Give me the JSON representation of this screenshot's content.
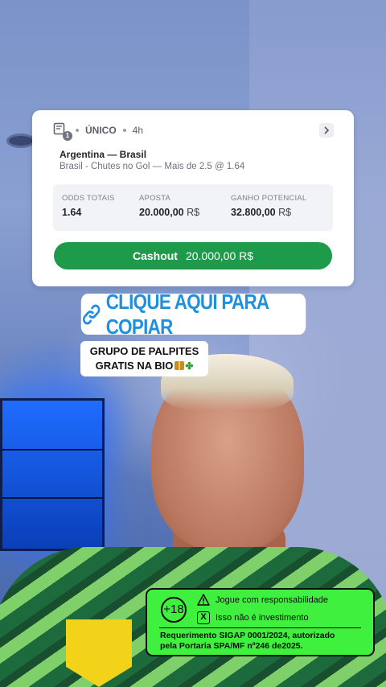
{
  "bet_slip": {
    "count": "1",
    "type": "ÚNICO",
    "time": "4h",
    "match": "Argentina — Brasil",
    "selection": "Brasil - Chutes no Gol — Mais de 2.5 @ 1.64",
    "stats": {
      "odds_label": "ODDS TOTAIS",
      "odds_value": "1.64",
      "stake_label": "APOSTA",
      "stake_value": "20.000,00",
      "stake_currency": "R$",
      "potential_label": "GANHO POTENCIAL",
      "potential_value": "32.800,00",
      "potential_currency": "R$"
    },
    "cashout": {
      "label": "Cashout",
      "amount": "20.000,00 R$",
      "color": "#1e9a4b"
    }
  },
  "copy_banner": {
    "text": "CLIQUE AQUI PARA COPIAR",
    "color": "#1f8fe0",
    "icon": "link-icon"
  },
  "group_label": {
    "line1": "GRUPO DE PALPITES",
    "line2": "GRATIS NA BIO"
  },
  "responsible": {
    "age": "+18",
    "line1": "Jogue com responsabilidade",
    "line2": "Isso não é investimento",
    "x_mark": "X",
    "legal_line1": "Requerimento SIGAP 0001/2024, autorizado",
    "legal_line2": "pela Portaria SPA/MF nº246 de2025.",
    "color": "#3ff03f"
  }
}
